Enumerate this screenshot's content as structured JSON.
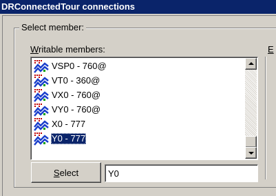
{
  "window": {
    "title": "DRConnectedTour connections"
  },
  "group": {
    "label": "Select member:"
  },
  "writable": {
    "label_prefix": "W",
    "label_rest": "ritable members:"
  },
  "right_column": {
    "label": "E"
  },
  "members": [
    {
      "label": "VSP0 - 760@",
      "icon": "dipl-member-icon",
      "selected": false
    },
    {
      "label": "VT0 - 360@",
      "icon": "dipl-member-icon",
      "selected": false
    },
    {
      "label": "VX0 - 760@",
      "icon": "dipl-member-icon",
      "selected": false
    },
    {
      "label": "VY0 - 760@",
      "icon": "dipl-member-icon",
      "selected": false
    },
    {
      "label": "X0 - 777",
      "icon": "dipl-member-icon",
      "selected": false
    },
    {
      "label": "Y0 - 777",
      "icon": "dipl-member-icon",
      "selected": true
    }
  ],
  "scrollbar": {
    "position_fraction": 0.9
  },
  "select_button": {
    "label_prefix": "S",
    "label_rest": "elect"
  },
  "selection_field": {
    "value": "Y0"
  }
}
